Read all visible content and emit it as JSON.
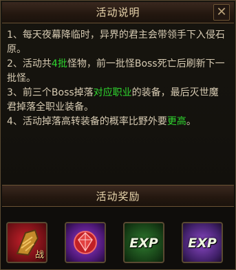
{
  "panel": {
    "title": "活动说明"
  },
  "description": {
    "lines": [
      {
        "pre": "1、每天夜幕降临时，异界的君主会带领手下入侵石原。",
        "hl": "",
        "post": ""
      },
      {
        "pre": "2、活动共",
        "hl": "4批",
        "post": "怪物，前一批怪Boss死亡后刷新下一批怪。"
      },
      {
        "pre": "3、前三个Boss掉落",
        "hl": "对应职业",
        "post": "的装备，最后灭世魔君掉落全职业装备。"
      },
      {
        "pre": "4、活动掉落高转装备的概率比野外要",
        "hl": "更高",
        "post": "。"
      }
    ]
  },
  "rewards": {
    "title": "活动奖励",
    "items": [
      {
        "icon": "gauntlet-icon",
        "tag": "战"
      },
      {
        "icon": "gem-icon",
        "tag": ""
      },
      {
        "icon": "exp-green-icon",
        "label": "EXP"
      },
      {
        "icon": "exp-purple-icon",
        "label": "EXP"
      }
    ]
  },
  "colors": {
    "highlight": "#2fd62f",
    "text": "#d7cbb3",
    "title": "#e9d6ad"
  }
}
